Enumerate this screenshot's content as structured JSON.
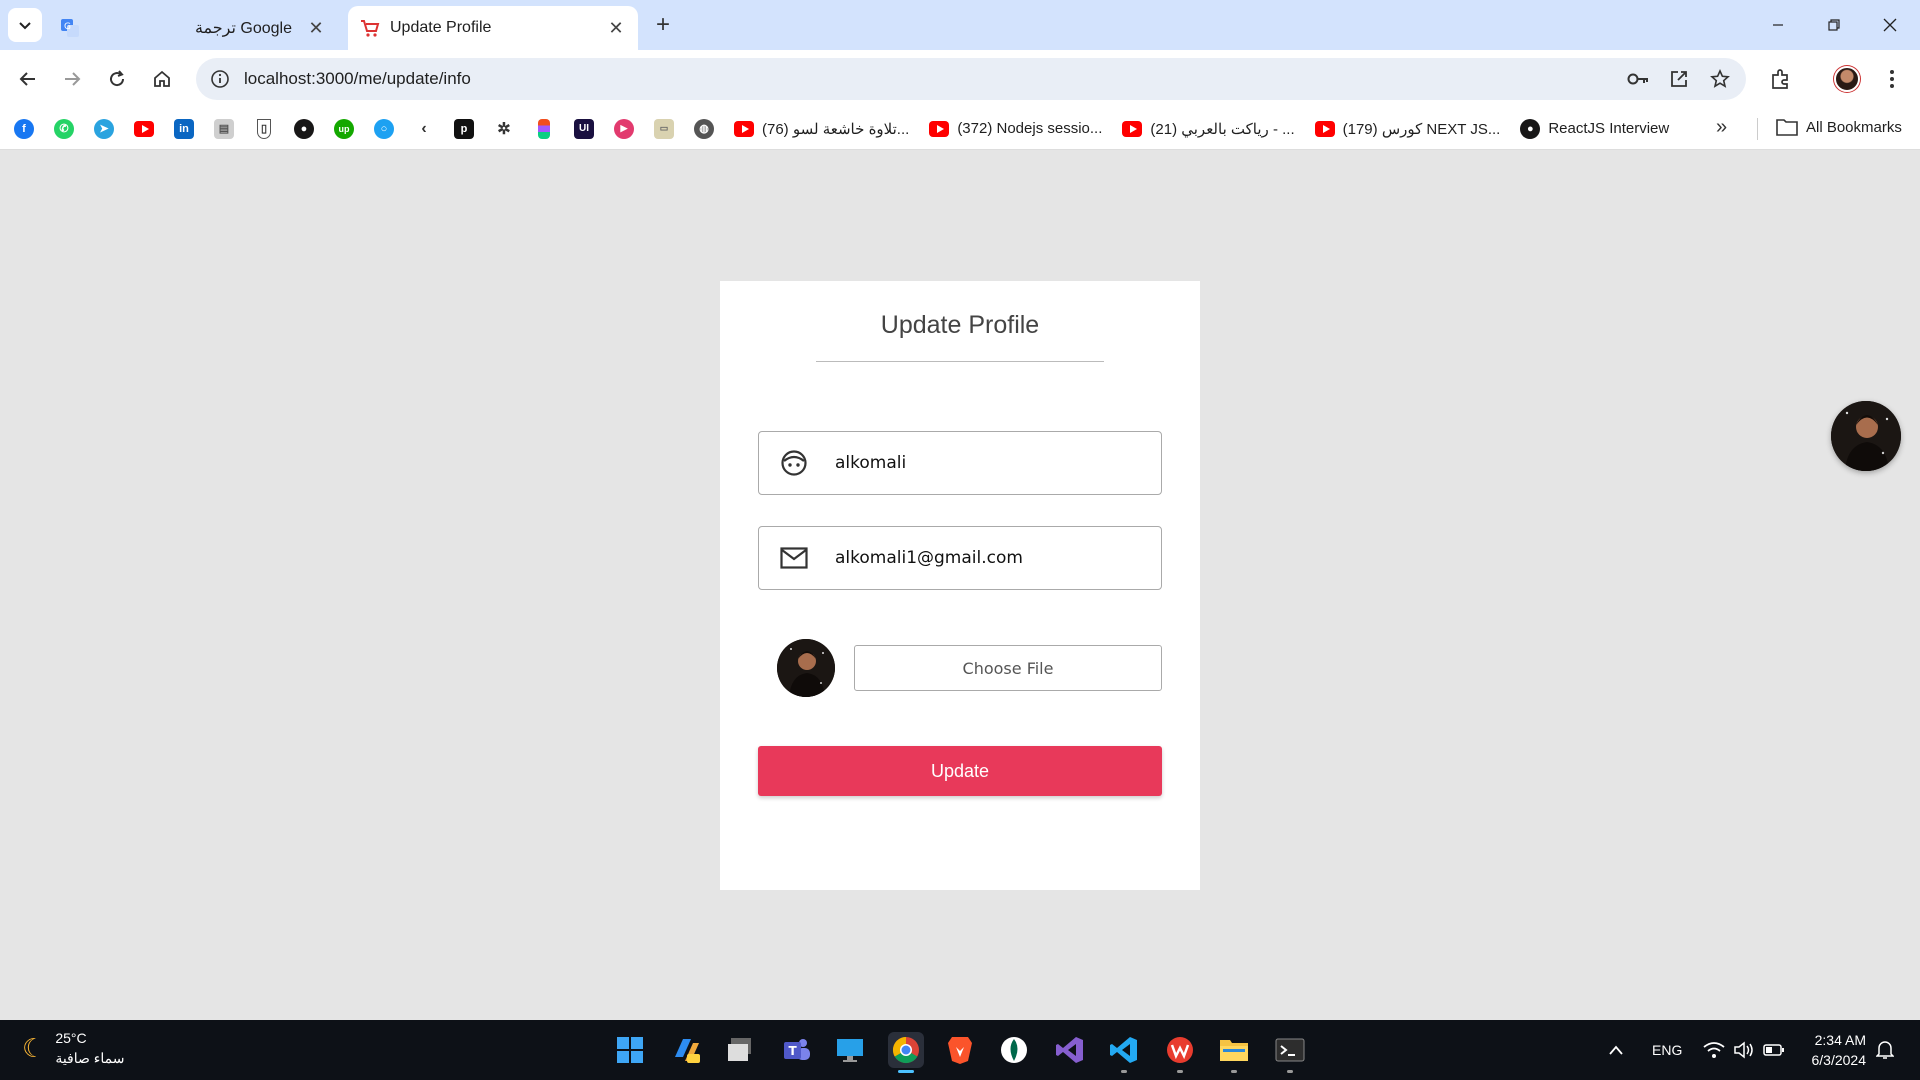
{
  "browser": {
    "tabs": [
      {
        "title": "ترجمة Google",
        "active": false
      },
      {
        "title": "Update Profile",
        "active": true
      }
    ],
    "url": "localhost:3000/me/update/info",
    "bookmarks_named": [
      {
        "label": "(76) تلاوة خاشعة لسو...",
        "icon": "youtube-icon"
      },
      {
        "label": "(372) Nodejs sessio...",
        "icon": "youtube-icon"
      },
      {
        "label": "(21) رياكت بالعربي - ...",
        "icon": "youtube-icon"
      },
      {
        "label": "(179) كورس NEXT JS...",
        "icon": "youtube-icon"
      },
      {
        "label": "ReactJS Interview",
        "icon": "github-icon"
      }
    ],
    "all_bookmarks": "All Bookmarks"
  },
  "page": {
    "title": "Update Profile",
    "name_value": "alkomali",
    "email_value": "alkomali1@gmail.com",
    "choose_file_label": "Choose File",
    "update_label": "Update",
    "accent": "#e8395a"
  },
  "taskbar": {
    "temperature": "25°C",
    "condition": "سماء صافية",
    "language": "ENG",
    "time": "2:34 AM",
    "date": "6/3/2024"
  }
}
